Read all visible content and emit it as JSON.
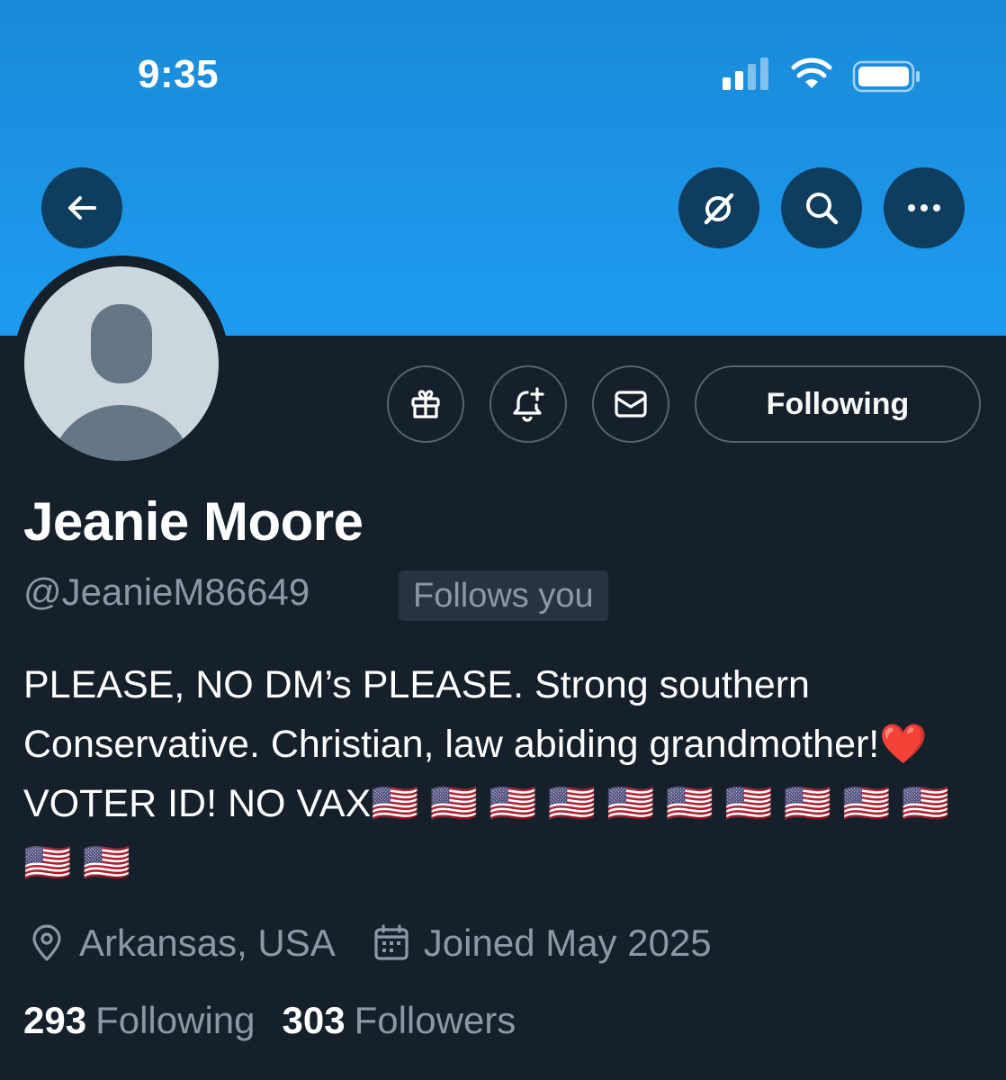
{
  "status_bar": {
    "time": "9:35",
    "icons": [
      "signal-icon",
      "wifi-icon",
      "battery-icon"
    ]
  },
  "header": {
    "back_icon": "back-arrow-icon",
    "actions": [
      "grok-icon",
      "search-icon",
      "more-icon"
    ],
    "banner_color": "#1d9bf0"
  },
  "profile_actions": {
    "icons": [
      "gift-icon",
      "notification-bell-icon",
      "message-icon"
    ],
    "following_label": "Following"
  },
  "profile": {
    "name": "Jeanie Moore",
    "handle": "@JeanieM86649",
    "follows_you": "Follows you",
    "bio": "PLEASE, NO DM’s PLEASE. Strong southern Conservative. Christian, law abiding grandmother!❤️ VOTER ID! NO VAX🇺🇸 🇺🇸 🇺🇸 🇺🇸 🇺🇸 🇺🇸 🇺🇸 🇺🇸 🇺🇸 🇺🇸 🇺🇸 🇺🇸",
    "location": "Arkansas, USA",
    "joined": "Joined May 2025",
    "following_count": "293",
    "following_label": "Following",
    "followers_count": "303",
    "followers_label": "Followers"
  },
  "colors": {
    "background": "#15202b",
    "accent": "#1d9bf0",
    "secondary_text": "#8b98a5"
  }
}
